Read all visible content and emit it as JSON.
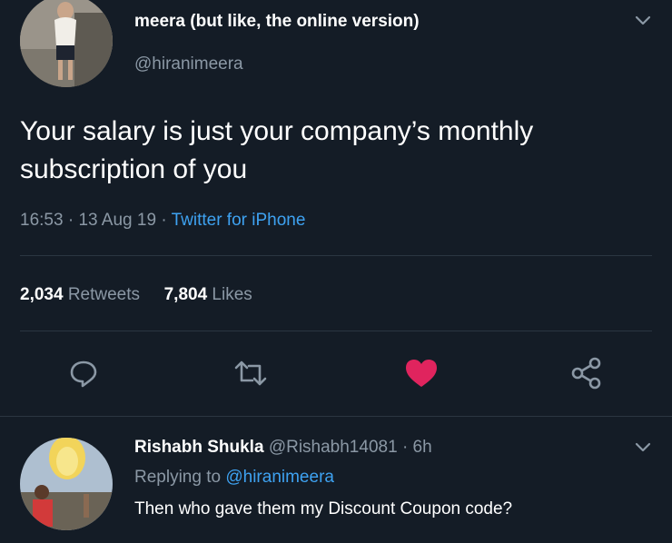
{
  "tweet": {
    "author_name": "meera (but like, the online version)",
    "author_handle": "@hiranimeera",
    "text_line1": "Your salary is just your company’s monthly",
    "text_line2": "subscription of you",
    "time": "16:53",
    "sep1": "·",
    "date": "13 Aug 19",
    "sep2": "·",
    "source": "Twitter for iPhone",
    "retweets_count": "2,034",
    "retweets_label": "Retweets",
    "likes_count": "7,804",
    "likes_label": "Likes"
  },
  "actions": {
    "reply_icon": "reply-icon",
    "retweet_icon": "retweet-icon",
    "like_icon": "heart-icon",
    "share_icon": "share-icon",
    "like_color": "#e0245e"
  },
  "reply": {
    "author_name": "Rishabh Shukla",
    "author_handle": "@Rishabh14081",
    "sep": "·",
    "age": "6h",
    "replying_prefix": "Replying to",
    "replying_handle": "@hiranimeera",
    "text": "Then who gave them my Discount Coupon code?"
  }
}
